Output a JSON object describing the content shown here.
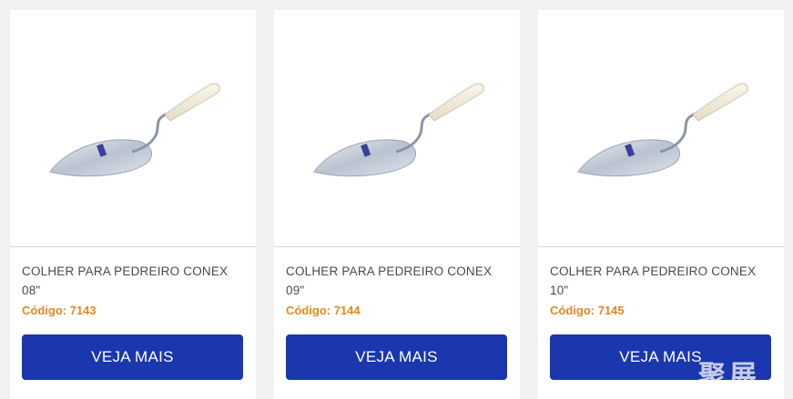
{
  "products": [
    {
      "title": "COLHER PARA PEDREIRO CONEX 08\"",
      "code": "Código: 7143",
      "button": "VEJA MAIS",
      "image_icon": "trowel-icon"
    },
    {
      "title": "COLHER PARA PEDREIRO CONEX 09\"",
      "code": "Código: 7144",
      "button": "VEJA MAIS",
      "image_icon": "trowel-icon"
    },
    {
      "title": "COLHER PARA PEDREIRO CONEX 10\"",
      "code": "Código: 7145",
      "button": "VEJA MAIS",
      "image_icon": "trowel-icon"
    }
  ],
  "watermark": "聚展",
  "colors": {
    "button": "#1a37ad",
    "code": "#e8861f",
    "title": "#4a4a4a",
    "background": "#f1f1f1"
  }
}
